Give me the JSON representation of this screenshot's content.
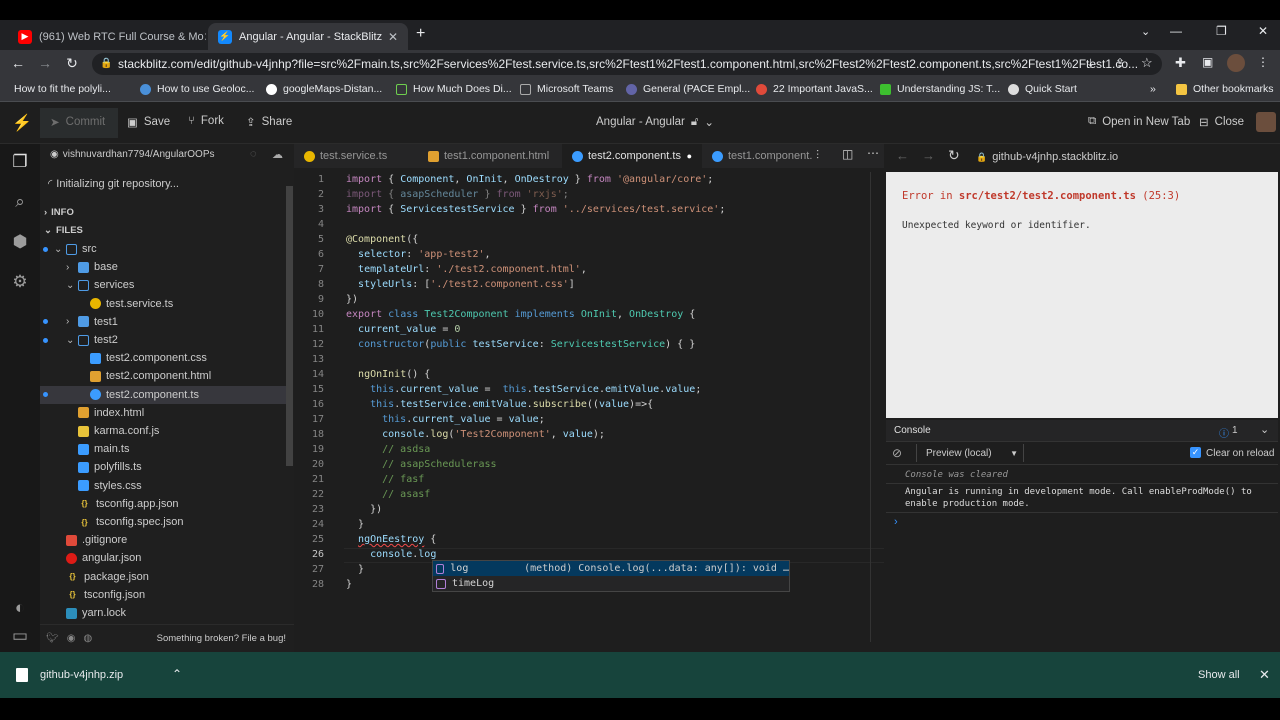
{
  "browser": {
    "tabs": [
      {
        "title": "(961) Web RTC Full Course & Mo",
        "active": false
      },
      {
        "title": "Angular - Angular - StackBlitz",
        "active": true
      }
    ],
    "new_tab": "+",
    "url": "stackblitz.com/edit/github-v4jnhp?file=src%2Fmain.ts,src%2Fservices%2Ftest.service.ts,src%2Ftest1%2Ftest1.component.html,src%2Ftest2%2Ftest2.component.ts,src%2Ftest1%2Ftest1.co...",
    "bookmarks": [
      "How to fit the polyli...",
      "How to use Geoloc...",
      "googleMaps-Distan...",
      "How Much Does Di...",
      "Microsoft Teams",
      "General (PACE Empl...",
      "22 Important JavaS...",
      "Understanding JS: T...",
      "Quick Start"
    ],
    "bookmarks_more": "»",
    "other_bookmarks": "Other bookmarks"
  },
  "toolbar": {
    "commit": "Commit",
    "save": "Save",
    "fork": "Fork",
    "share": "Share",
    "project_title": "Angular - Angular",
    "open_new_tab": "Open in New Tab",
    "close": "Close"
  },
  "sidebar": {
    "repo": "vishnuvardhan7794/AngularOOPs",
    "status": "Initializing git repository...",
    "info": "INFO",
    "files": "FILES",
    "tree": [
      {
        "label": "src",
        "kind": "folder-open",
        "depth": 0,
        "dot": true
      },
      {
        "label": "base",
        "kind": "folder",
        "depth": 1,
        "dot": false
      },
      {
        "label": "services",
        "kind": "folder-open",
        "depth": 1,
        "dot": false
      },
      {
        "label": "test.service.ts",
        "kind": "angular",
        "depth": 2,
        "dot": false
      },
      {
        "label": "test1",
        "kind": "folder",
        "depth": 1,
        "dot": true
      },
      {
        "label": "test2",
        "kind": "folder-open",
        "depth": 1,
        "dot": true
      },
      {
        "label": "test2.component.css",
        "kind": "css",
        "depth": 2,
        "dot": false
      },
      {
        "label": "test2.component.html",
        "kind": "html",
        "depth": 2,
        "dot": false
      },
      {
        "label": "test2.component.ts",
        "kind": "ts",
        "depth": 2,
        "dot": true,
        "selected": true
      },
      {
        "label": "index.html",
        "kind": "html",
        "depth": 1,
        "dot": false
      },
      {
        "label": "karma.conf.js",
        "kind": "js",
        "depth": 1,
        "dot": false
      },
      {
        "label": "main.ts",
        "kind": "ts-file",
        "depth": 1,
        "dot": false
      },
      {
        "label": "polyfills.ts",
        "kind": "ts-file",
        "depth": 1,
        "dot": false
      },
      {
        "label": "styles.css",
        "kind": "css",
        "depth": 1,
        "dot": false
      },
      {
        "label": "tsconfig.app.json",
        "kind": "json",
        "depth": 1,
        "dot": false
      },
      {
        "label": "tsconfig.spec.json",
        "kind": "json",
        "depth": 1,
        "dot": false
      },
      {
        "label": ".gitignore",
        "kind": "git",
        "depth": 0,
        "dot": false
      },
      {
        "label": "angular.json",
        "kind": "angular-red",
        "depth": 0,
        "dot": false
      },
      {
        "label": "package.json",
        "kind": "json",
        "depth": 0,
        "dot": false
      },
      {
        "label": "tsconfig.json",
        "kind": "json",
        "depth": 0,
        "dot": false
      },
      {
        "label": "yarn.lock",
        "kind": "yarn",
        "depth": 0,
        "dot": false
      }
    ],
    "footer_link": "Something broken? File a bug!"
  },
  "editor": {
    "tabs": [
      {
        "label": "test.service.ts",
        "active": false
      },
      {
        "label": "test1.component.html",
        "active": false
      },
      {
        "label": "test2.component.ts",
        "active": true,
        "dirty": true
      },
      {
        "label": "test1.component.",
        "active": false
      }
    ],
    "line_numbers": [
      "1",
      "2",
      "3",
      "4",
      "5",
      "6",
      "7",
      "8",
      "9",
      "10",
      "11",
      "12",
      "13",
      "14",
      "15",
      "16",
      "17",
      "18",
      "19",
      "20",
      "21",
      "22",
      "23",
      "24",
      "25",
      "26",
      "27",
      "28"
    ],
    "suggestions": [
      {
        "label": "log",
        "detail": "(method) Console.log(...data: any[]): void …"
      },
      {
        "label": "timeLog",
        "detail": ""
      }
    ]
  },
  "preview": {
    "url": "github-v4jnhp.stackblitz.io",
    "error_prefix": "Error in",
    "error_file": "src/test2/test2.component.ts",
    "error_loc": "(25:3)",
    "error_message": "Unexpected keyword or identifier.",
    "console_tab": "Console",
    "issues_count": "1",
    "context": "Preview (local)",
    "clear_on_reload": "Clear on reload",
    "console_lines": [
      "Console was cleared",
      "Angular is running in development mode. Call enableProdMode() to",
      "enable production mode."
    ],
    "prompt": "›"
  },
  "downloads": {
    "file": "github-v4jnhp.zip",
    "show_all": "Show all"
  },
  "colors": {
    "accent": "#1389fd",
    "download_bar": "#17443c",
    "error_text": "#c0392b"
  }
}
